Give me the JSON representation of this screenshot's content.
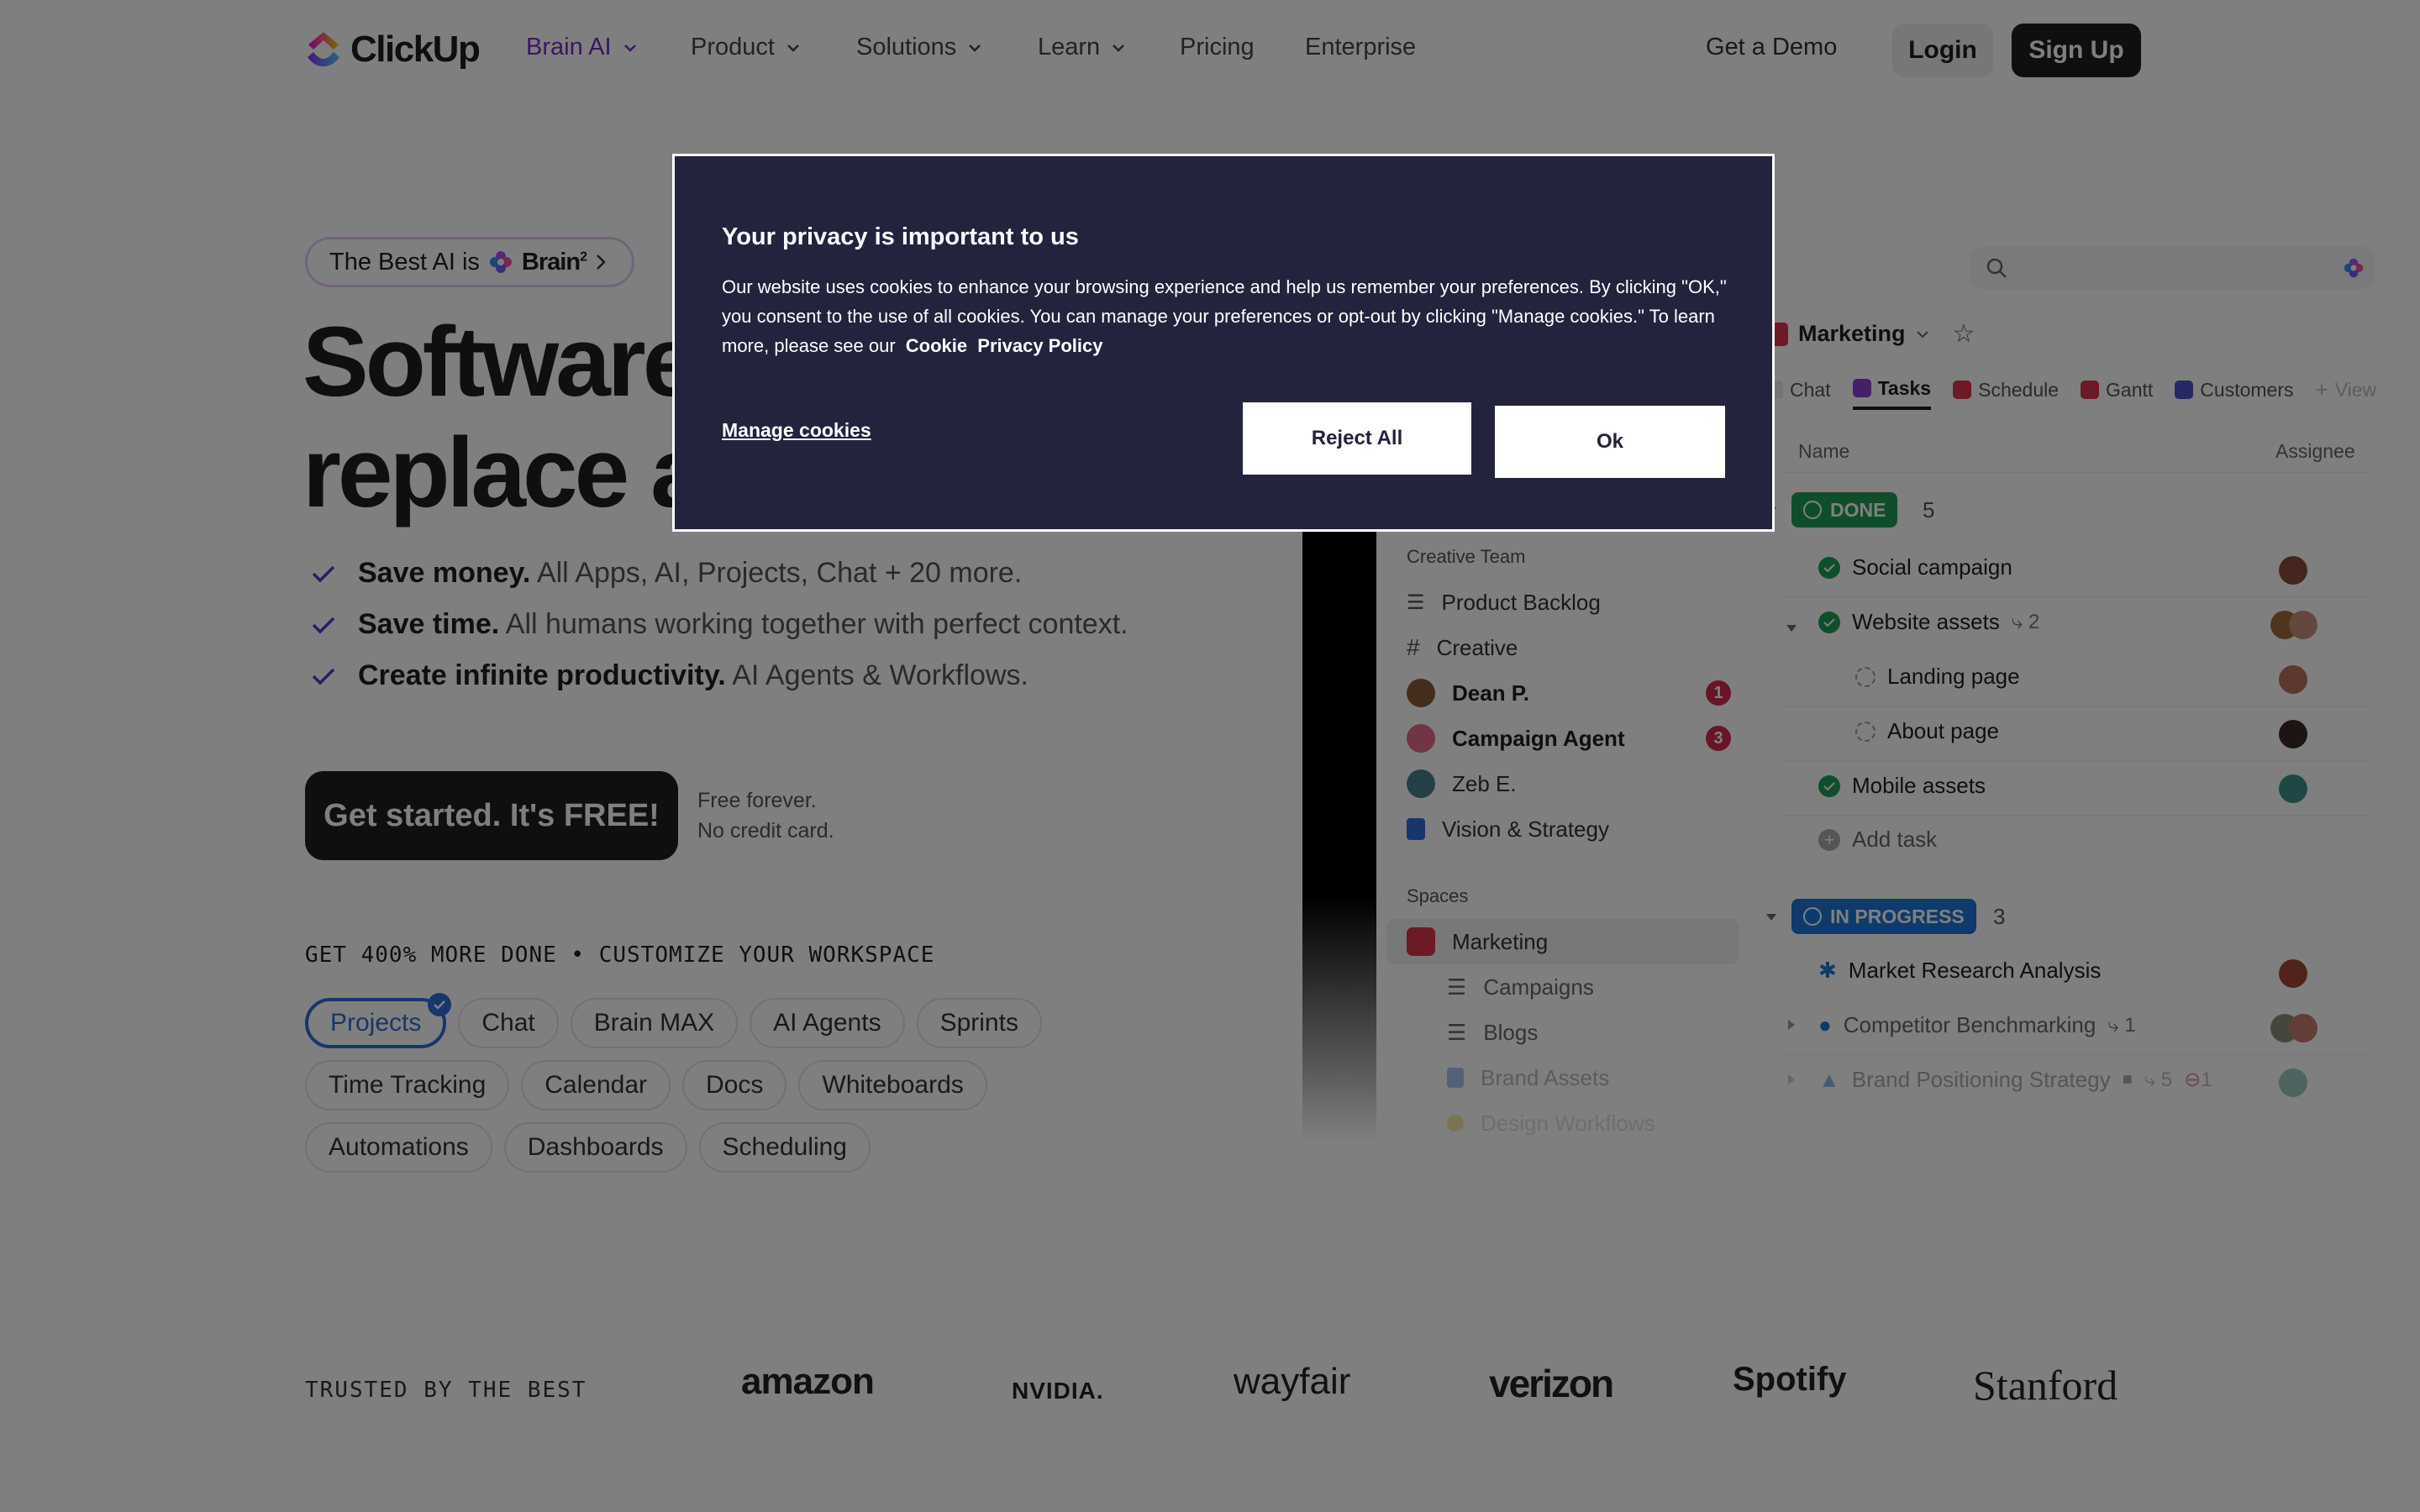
{
  "nav": {
    "logo_text": "ClickUp",
    "items": [
      {
        "label": "Brain AI",
        "has_menu": true,
        "color": "#7b2cbf"
      },
      {
        "label": "Product",
        "has_menu": true
      },
      {
        "label": "Solutions",
        "has_menu": true
      },
      {
        "label": "Learn",
        "has_menu": true
      },
      {
        "label": "Pricing",
        "has_menu": false
      },
      {
        "label": "Enterprise",
        "has_menu": false
      }
    ],
    "demo_label": "Get a Demo",
    "login_label": "Login",
    "signup_label": "Sign Up"
  },
  "hero": {
    "pill_text": "The Best AI is",
    "pill_brand": "Brain",
    "pill_sup": "2",
    "title_line1": "Software",
    "title_line2": "replace a",
    "bullets": [
      {
        "bold": "Save money.",
        "text": "All Apps, AI, Projects, Chat + 20 more."
      },
      {
        "bold": "Save time.",
        "text": "All humans working together with perfect context."
      },
      {
        "bold": "Create infinite productivity.",
        "text": "AI Agents & Workflows."
      }
    ],
    "cta_label": "Get started. It's FREE!",
    "cta_note_1": "Free forever.",
    "cta_note_2": "No credit card.",
    "customize_label": "GET 400% MORE DONE • CUSTOMIZE YOUR WORKSPACE",
    "chips_row1": [
      "Projects",
      "Chat",
      "Brain MAX",
      "AI Agents",
      "Sprints"
    ],
    "chips_row2": [
      "Time Tracking",
      "Calendar",
      "Docs",
      "Whiteboards"
    ],
    "chips_row3": [
      "Automations",
      "Dashboards",
      "Scheduling"
    ],
    "active_chip": "Projects"
  },
  "trusted": {
    "label": "TRUSTED BY THE BEST",
    "brands": [
      "amazon",
      "NVIDIA.",
      "wayfair",
      "verizon",
      "Spotify",
      "Stanford"
    ]
  },
  "app": {
    "sidebar": {
      "team_heading": "Creative Team",
      "team_items": [
        {
          "label": "Product Backlog",
          "icon": "list-icon"
        },
        {
          "label": "Creative",
          "icon": "hash-icon"
        },
        {
          "label": "Dean P.",
          "icon": "avatar",
          "badge": "1"
        },
        {
          "label": "Campaign Agent",
          "icon": "avatar",
          "badge": "3"
        },
        {
          "label": "Zeb E.",
          "icon": "avatar"
        },
        {
          "label": "Vision & Strategy",
          "icon": "doc-icon"
        }
      ],
      "spaces_heading": "Spaces",
      "space_selected": "Marketing",
      "space_items": [
        "Campaigns",
        "Blogs",
        "Brand Assets",
        "Design Workflows"
      ]
    },
    "space_title": "Marketing",
    "tabs": [
      "Chat",
      "Tasks",
      "Schedule",
      "Gantt",
      "Customers",
      "View"
    ],
    "active_tab": "Tasks",
    "col_name": "Name",
    "col_assignee": "Assignee",
    "groups": [
      {
        "status": "DONE",
        "count": "5",
        "color": "#1f9d55",
        "tasks": [
          {
            "name": "Social campaign",
            "state": "done"
          },
          {
            "name": "Website assets",
            "state": "done",
            "subcount": "2"
          },
          {
            "name": "Landing page",
            "state": "todo",
            "sub": true
          },
          {
            "name": "About page",
            "state": "todo",
            "sub": true
          },
          {
            "name": "Mobile assets",
            "state": "done"
          }
        ],
        "add_label": "Add task"
      },
      {
        "status": "IN PROGRESS",
        "count": "3",
        "color": "#1d74d8",
        "tasks": [
          {
            "name": "Market Research Analysis"
          },
          {
            "name": "Competitor Benchmarking",
            "subcount": "1"
          },
          {
            "name": "Brand Positioning Strategy",
            "subcount": "5",
            "blocked": "1"
          }
        ]
      }
    ]
  },
  "cookie": {
    "title": "Your privacy is important to us",
    "body": "Our website uses cookies to enhance your browsing experience and help us remember your preferences. By clicking \"OK,\" you consent to the use of all cookies. You can manage your preferences or opt-out by clicking \"Manage cookies.\" To learn more, please see our",
    "link_cookie": "Cookie",
    "link_privacy": "Privacy Policy",
    "manage_label": "Manage cookies",
    "reject_label": "Reject All",
    "ok_label": "Ok"
  }
}
